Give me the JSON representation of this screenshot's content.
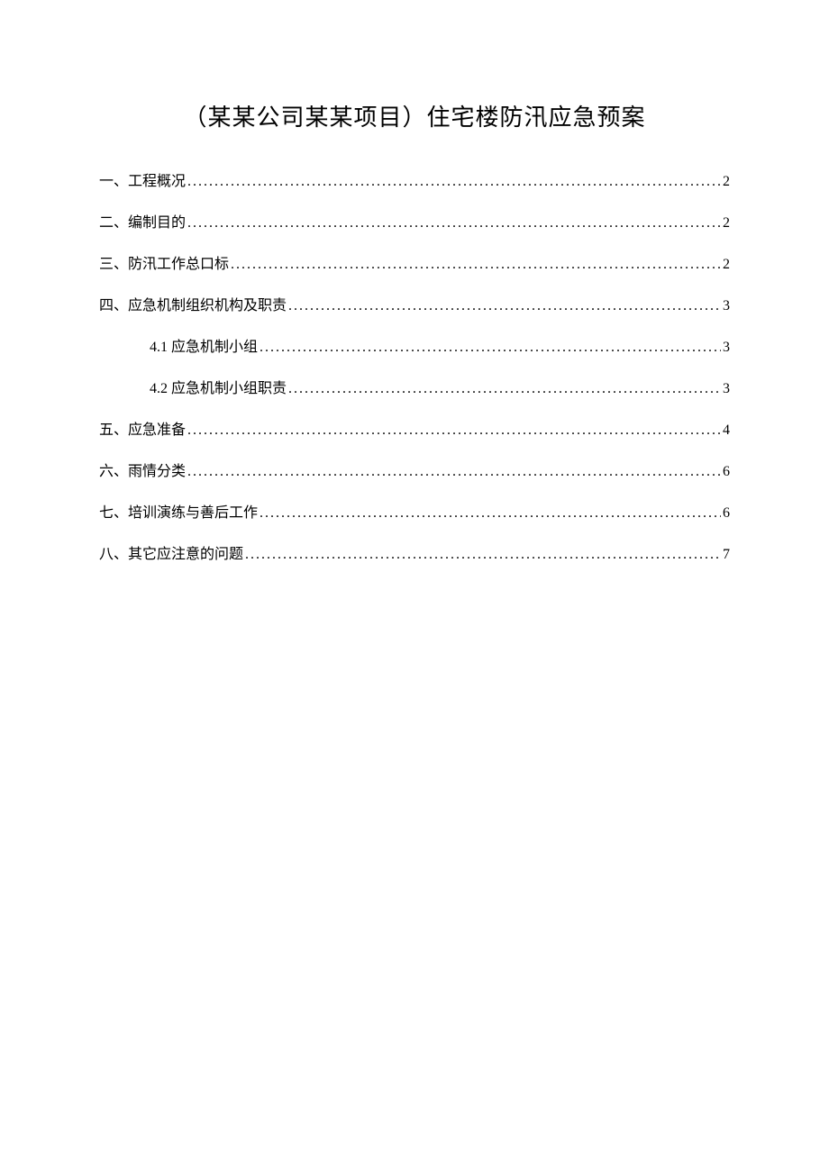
{
  "title": "（某某公司某某项目）住宅楼防汛应急预案",
  "toc": [
    {
      "label": "一、工程概况",
      "page": "2",
      "indent": false
    },
    {
      "label": "二、编制目的",
      "page": "2",
      "indent": false
    },
    {
      "label": "三、防汛工作总口标",
      "page": "2",
      "indent": false
    },
    {
      "label": "四、应急机制组织机构及职责",
      "page": "3",
      "indent": false
    },
    {
      "label": "4.1  应急机制小组",
      "page": "3",
      "indent": true
    },
    {
      "label": "4.2  应急机制小组职责",
      "page": "3",
      "indent": true
    },
    {
      "label": "五、应急准备",
      "page": "4",
      "indent": false
    },
    {
      "label": "六、雨情分类",
      "page": "6",
      "indent": false
    },
    {
      "label": "七、培训演练与善后工作",
      "page": "6",
      "indent": false
    },
    {
      "label": "八、其它应注意的问题",
      "page": "7",
      "indent": false
    }
  ]
}
